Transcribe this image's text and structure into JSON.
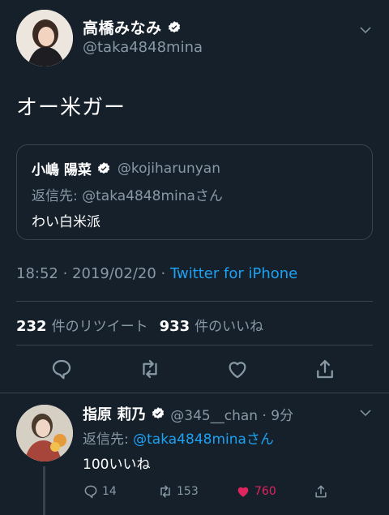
{
  "main_tweet": {
    "display_name": "高橋みなみ",
    "handle": "@taka4848mina",
    "text": "オー米ガー",
    "timestamp": "18:52 · 2019/02/20 · ",
    "source": "Twitter for iPhone"
  },
  "quote": {
    "display_name": "小嶋 陽菜",
    "handle": "@kojiharunyan",
    "reply_prefix": "返信先: @taka4848minaさん",
    "text": "わい白米派"
  },
  "stats": {
    "retweets_count": "232",
    "retweets_label": "件のリツイート",
    "likes_count": "933",
    "likes_label": "件のいいね"
  },
  "reply_tweet": {
    "display_name": "指原 莉乃",
    "handle_time": "@345__chan · 9分",
    "reply_prefix": "返信先: ",
    "reply_target": "@taka4848minaさん",
    "text": "100いいね",
    "reply_count": "14",
    "retweet_count": "153",
    "like_count": "760"
  },
  "colors": {
    "background": "#15202b",
    "accent": "#1da1f2",
    "muted": "#8899a6",
    "like": "#e0245e"
  }
}
